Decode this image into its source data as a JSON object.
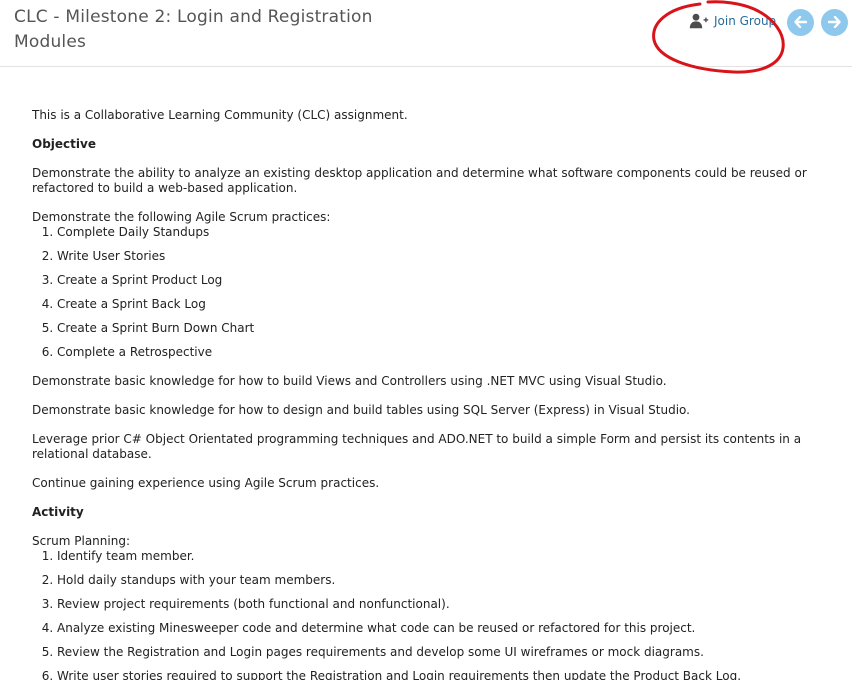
{
  "header": {
    "title": "CLC - Milestone 2: Login and Registration Modules",
    "join_group_label": "Join Group",
    "join_group_icon": "add-user-icon",
    "prev_icon": "arrow-left-icon",
    "next_icon": "arrow-right-icon",
    "nav_button_color": "#8ec8ec",
    "annotation_color": "#d8141a"
  },
  "content": {
    "intro": "This is a Collaborative Learning Community (CLC) assignment.",
    "objective_heading": "Objective",
    "objective_para1": "Demonstrate the ability to analyze an existing desktop application and determine what software components could be reused or refactored to build a web-based application.",
    "scrum_lead": "Demonstrate the following Agile Scrum practices:",
    "scrum_items": [
      "Complete Daily Standups",
      "Write User Stories",
      "Create a Sprint Product Log",
      "Create a Sprint Back Log",
      "Create a Sprint Burn Down Chart",
      "Complete a Retrospective"
    ],
    "para_mvc": "Demonstrate basic knowledge for how to build Views and Controllers using .NET MVC using Visual Studio.",
    "para_sql": "Demonstrate basic knowledge for how to design and build tables using SQL Server (Express) in Visual Studio.",
    "para_ado": "Leverage prior C# Object Orientated programming techniques and ADO.NET to build a simple Form and persist its contents in a relational database.",
    "para_continue": "Continue gaining experience using Agile Scrum practices.",
    "activity_heading": "Activity",
    "planning_lead": "Scrum Planning:",
    "planning_items": [
      "Identify team member.",
      "Hold daily standups with your team members.",
      "Review project requirements (both functional and nonfunctional).",
      "Analyze existing Minesweeper code and determine what code can be reused or refactored for this project.",
      "Review the Registration and Login pages requirements and develop some UI wireframes or mock diagrams.",
      "Write user stories required to support the Registration and Login requirements then update the Product Back Log."
    ]
  }
}
